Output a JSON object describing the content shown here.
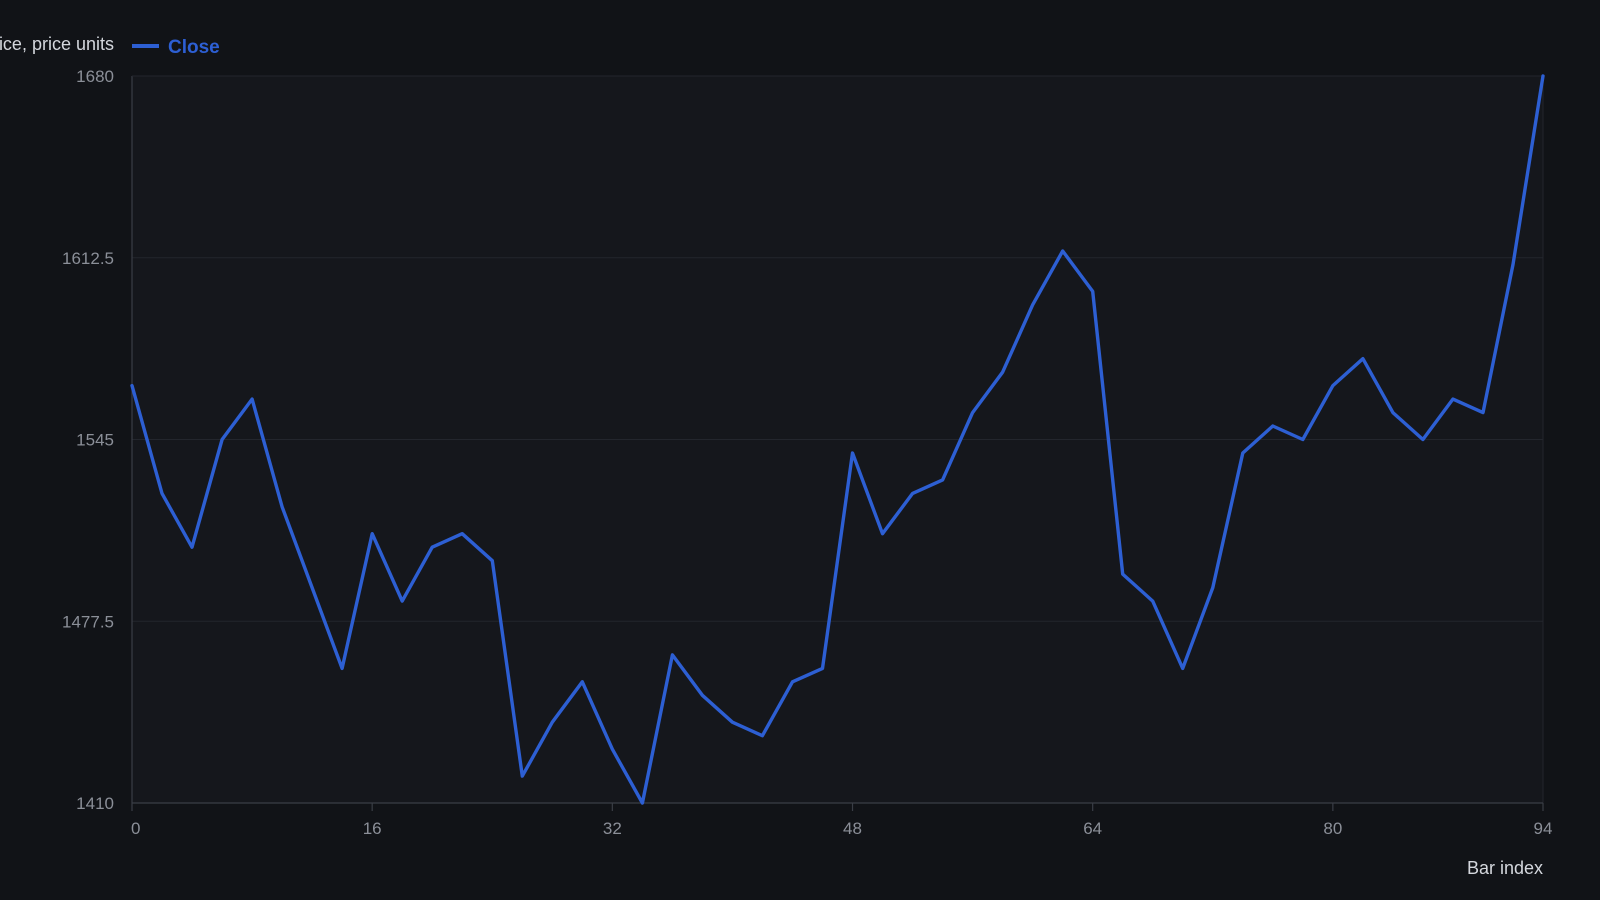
{
  "chart_data": {
    "type": "line",
    "ylabel": "Price, price units",
    "xlabel": "Bar index",
    "xlim": [
      0,
      94
    ],
    "ylim": [
      1410,
      1680
    ],
    "x_ticks": [
      0,
      16,
      32,
      48,
      64,
      80,
      94
    ],
    "y_ticks": [
      1410,
      1477.5,
      1545,
      1612.5,
      1680
    ],
    "y_tick_labels": [
      "1410",
      "1477.5",
      "1545",
      "1612.5",
      "1680"
    ],
    "grid": true,
    "legend_position": "top-left",
    "series": [
      {
        "name": "Close",
        "color": "#2d5fd3",
        "x": [
          0,
          2,
          4,
          6,
          8,
          10,
          12,
          14,
          16,
          18,
          20,
          22,
          24,
          26,
          28,
          30,
          32,
          34,
          36,
          38,
          40,
          42,
          44,
          46,
          48,
          50,
          52,
          54,
          56,
          58,
          60,
          62,
          64,
          66,
          68,
          70,
          72,
          74,
          76,
          78,
          80,
          82,
          84,
          86,
          88,
          90,
          92,
          94
        ],
        "y": [
          1565,
          1525,
          1505,
          1545,
          1560,
          1520,
          1490,
          1460,
          1510,
          1485,
          1505,
          1510,
          1500,
          1420,
          1440,
          1455,
          1430,
          1410,
          1465,
          1450,
          1440,
          1435,
          1455,
          1460,
          1540,
          1510,
          1525,
          1530,
          1555,
          1570,
          1595,
          1615,
          1600,
          1495,
          1485,
          1460,
          1490,
          1540,
          1550,
          1545,
          1565,
          1575,
          1555,
          1545,
          1560,
          1555,
          1610,
          1680
        ]
      }
    ]
  },
  "colors": {
    "background": "#111317",
    "plot_background": "#15171c",
    "grid": "#23262d",
    "axis": "#3a3e46",
    "line": "#2d5fd3"
  }
}
